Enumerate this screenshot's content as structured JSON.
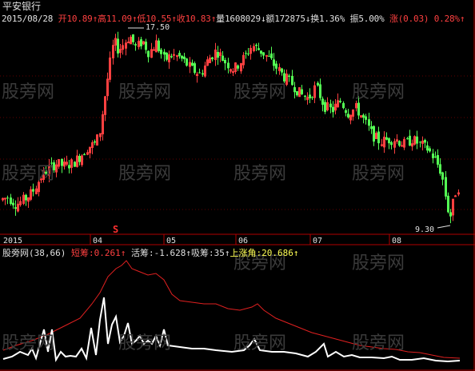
{
  "title": "平安银行",
  "info": {
    "date": "2015/08/28",
    "open_label": "开",
    "open": "10.89",
    "high_label": "高",
    "high": "11.09",
    "low_label": "低",
    "low": "10.55",
    "close_label": "收",
    "close": "10.83",
    "volume_label": "量",
    "volume": "1608029",
    "amount_label": "额",
    "amount": "172875",
    "turnover_label": "换",
    "turnover": "1.36%",
    "amplitude_label": "振",
    "amplitude": "5.00%",
    "change_label": "涨",
    "change": "(0.03)",
    "change_pct": "0.28%"
  },
  "watermark": "股旁网",
  "price_high_label": "17.50",
  "price_low_label": "9.30",
  "s_marker": "S",
  "months": [
    "2015",
    "04",
    "05",
    "06",
    "07",
    "08"
  ],
  "indicator": {
    "name": "股旁网",
    "params": "(38,66)",
    "short_label": "短筹",
    "short_value": "0.261",
    "active_label": "活筹",
    "active_value": "-1.628",
    "absorb_label": "吸筹",
    "absorb_value": "35",
    "angle_label": "上涨角",
    "angle_value": "20.686"
  },
  "colors": {
    "background": "#000000",
    "up": "#ff4040",
    "down": "#54ff54",
    "text": "#e0e0e0",
    "label_red": "#ff4040",
    "label_yellow": "#ffff54",
    "axis": "#b00000",
    "white_line": "#ffffff",
    "red_line": "#e02020"
  },
  "chart_data": {
    "type": "candlestick",
    "price_range": [
      9.3,
      17.5
    ],
    "x_labels": [
      "2015",
      "04",
      "05",
      "06",
      "07",
      "08"
    ],
    "price_annotations": [
      17.5,
      9.3
    ],
    "indicator_lines": [
      "短筹",
      "活筹",
      "吸筹",
      "上涨角"
    ]
  }
}
